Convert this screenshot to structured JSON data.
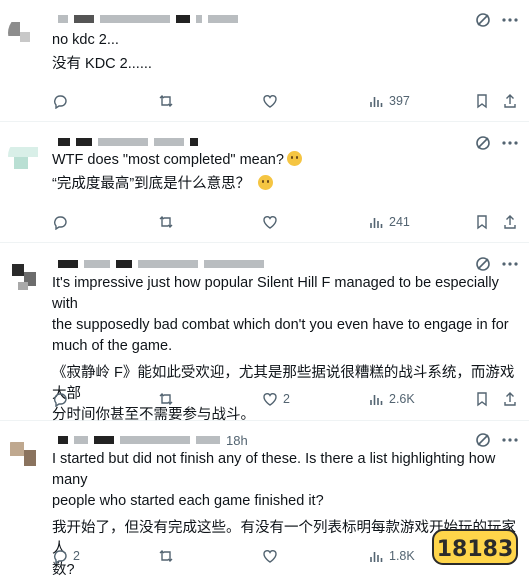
{
  "posts": [
    {
      "name_suffix": "",
      "lines_en": [
        "no kdc 2..."
      ],
      "lines_zh": [
        "没有 KDC 2......"
      ],
      "reply_count": "",
      "like_count": "",
      "views": "397"
    },
    {
      "name_suffix": "",
      "lines_en": [
        "WTF does \"most completed\" mean?"
      ],
      "lines_zh": [
        "“完成度最高”到底是什么意思？"
      ],
      "reply_count": "",
      "like_count": "",
      "views": "241"
    },
    {
      "name_suffix": "",
      "lines_en": [
        "It's impressive just how popular Silent Hill F managed to be especially with",
        "the supposedly bad combat which don't you even have to engage in for",
        "much of the game."
      ],
      "lines_zh": [
        "《寂静岭 F》能如此受欢迎，尤其是那些据说很糟糕的战斗系统，而游戏大部",
        "分时间你甚至不需要参与战斗。"
      ],
      "reply_count": "",
      "like_count": "2",
      "views": "2.6K"
    },
    {
      "name_suffix": "18h",
      "lines_en": [
        "I started but did not finish any of these. Is there a list highlighting how many",
        "people who started each game finished it?"
      ],
      "lines_zh": [
        "我开始了，但没有完成这些。有没有一个列表标明每款游戏开始玩的玩家人",
        "数?"
      ],
      "reply_count": "2",
      "like_count": "",
      "views": "1.8K"
    }
  ],
  "watermark_text": "18183",
  "colors": {
    "text": "#0f1419",
    "muted": "#536471",
    "divider": "#eff3f4",
    "watermark": "#f2b705"
  },
  "icons": [
    "reply-icon",
    "retweet-icon",
    "like-icon",
    "views-icon",
    "bookmark-icon",
    "share-icon",
    "grok-icon",
    "more-icon"
  ]
}
